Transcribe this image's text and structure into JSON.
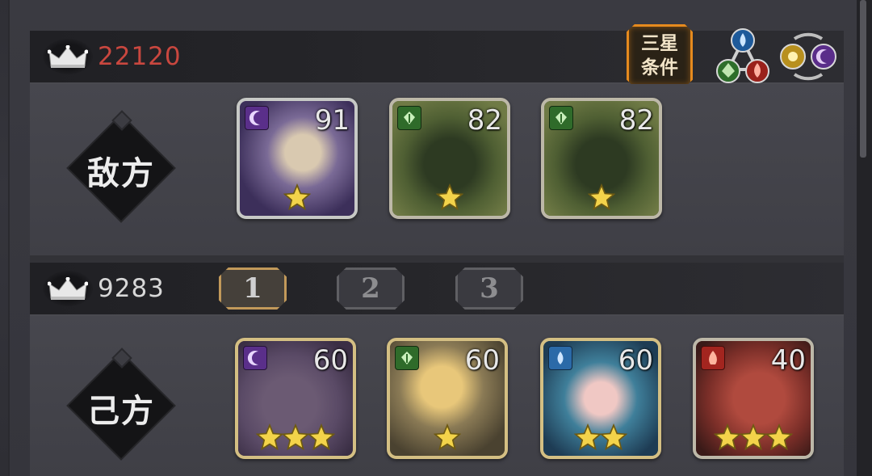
{
  "enemy": {
    "power": "22120",
    "side_label": "敌方",
    "three_star_button": {
      "line1": "三星",
      "line2": "条件"
    },
    "cards": [
      {
        "level": "91",
        "element": "moon",
        "stars": 1,
        "frame": "holo"
      },
      {
        "level": "82",
        "element": "leaf",
        "stars": 1,
        "frame": "silver"
      },
      {
        "level": "82",
        "element": "leaf",
        "stars": 1,
        "frame": "silver"
      }
    ]
  },
  "ally": {
    "power": "9283",
    "side_label": "己方",
    "team_tabs": [
      "1",
      "2",
      "3"
    ],
    "active_tab": "1",
    "cards": [
      {
        "level": "60",
        "element": "moon",
        "stars": 3,
        "frame": "gold"
      },
      {
        "level": "60",
        "element": "leaf",
        "stars": 1,
        "frame": "gold"
      },
      {
        "level": "60",
        "element": "water",
        "stars": 2,
        "frame": "gold"
      },
      {
        "level": "40",
        "element": "fire",
        "stars": 3,
        "frame": "silver"
      }
    ]
  },
  "icons": {
    "crown": "crown-icon",
    "element_chart": "element-chart-icon",
    "element_cycle": "element-cycle-icon"
  },
  "colors": {
    "enemy_power": "#c9473f",
    "ally_power": "#d8d8d8",
    "highlight": "#e58a1e",
    "star": "#f3d34a",
    "moon": "#5a2f8a",
    "leaf": "#2f6b2a",
    "water": "#2b6aa8",
    "fire": "#a3251f"
  }
}
